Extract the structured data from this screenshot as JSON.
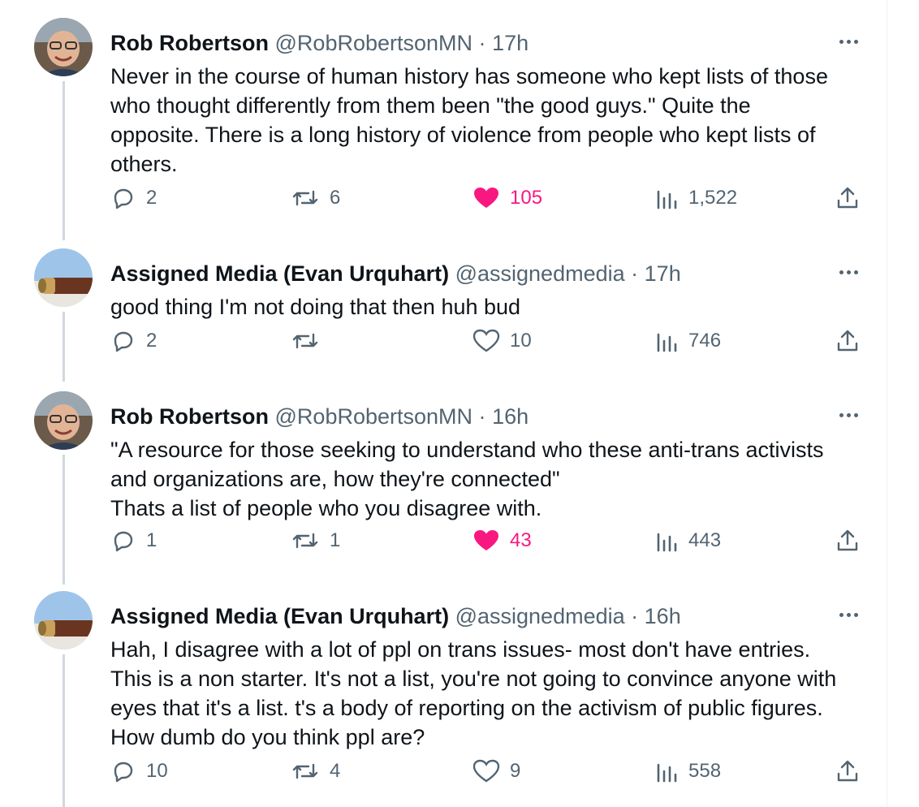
{
  "colors": {
    "liked": "#f91880",
    "muted": "#536471",
    "thread_line": "#cfd9de"
  },
  "tweets": [
    {
      "name": "Rob Robertson",
      "handle": "@RobRobertsonMN",
      "dot": "·",
      "time": "17h",
      "text": "Never in the course of human history has someone who kept lists of those\nwho thought differently from them been \"the good guys.\" Quite the\nopposite. There is a long history of violence from people who kept lists of\nothers.",
      "replies": "2",
      "reposts": "6",
      "likes": "105",
      "liked": true,
      "views": "1,522"
    },
    {
      "name": "Assigned Media (Evan Urquhart)",
      "handle": "@assignedmedia",
      "dot": "·",
      "time": "17h",
      "text": "good thing I'm not doing that then huh bud",
      "replies": "2",
      "reposts": "",
      "likes": "10",
      "liked": false,
      "views": "746"
    },
    {
      "name": "Rob Robertson",
      "handle": "@RobRobertsonMN",
      "dot": "·",
      "time": "16h",
      "text": "\"A resource for those seeking to understand who these anti-trans activists\nand organizations are, how they're connected\"\nThats a list of people who you disagree with.",
      "replies": "1",
      "reposts": "1",
      "likes": "43",
      "liked": true,
      "views": "443"
    },
    {
      "name": "Assigned Media (Evan Urquhart)",
      "handle": "@assignedmedia",
      "dot": "·",
      "time": "16h",
      "text": "Hah, I disagree with a lot of ppl on trans issues- most don't have entries.\nThis is a non starter. It's not a list, you're not going to convince anyone with\neyes that it's a list. t's a body of reporting on the activism of public figures.\nHow dumb do you think ppl are?",
      "replies": "10",
      "reposts": "4",
      "likes": "9",
      "liked": false,
      "views": "558"
    }
  ]
}
